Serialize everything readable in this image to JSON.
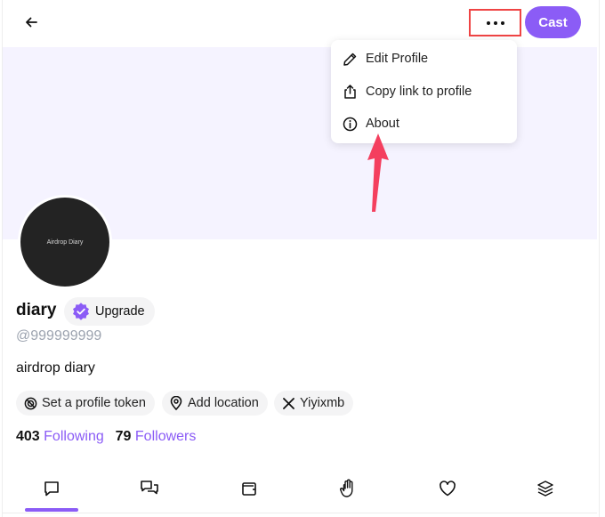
{
  "header": {
    "cast_label": "Cast",
    "back_icon": "arrow-left-icon",
    "more_icon": "ellipsis-icon"
  },
  "menu": {
    "items": [
      {
        "label": "Edit Profile",
        "icon": "pencil-icon"
      },
      {
        "label": "Copy link to profile",
        "icon": "share-icon"
      },
      {
        "label": "About",
        "icon": "info-icon"
      }
    ]
  },
  "profile": {
    "avatar_text": "Airdrop Diary",
    "name": "diary",
    "upgrade_label": "Upgrade",
    "handle": "@999999999",
    "bio": "airdrop diary",
    "chips": [
      {
        "label": "Set a profile token",
        "icon": "token-icon"
      },
      {
        "label": "Add location",
        "icon": "location-pin-icon"
      },
      {
        "label": "Yiyixmb",
        "icon": "x-logo-icon"
      }
    ],
    "following_count": "403",
    "following_label": "Following",
    "followers_count": "79",
    "followers_label": "Followers"
  },
  "tabs": [
    {
      "icon": "chat-bubble-icon",
      "active": true
    },
    {
      "icon": "replies-icon",
      "active": false
    },
    {
      "icon": "wallet-icon",
      "active": false
    },
    {
      "icon": "hand-icon",
      "active": false
    },
    {
      "icon": "heart-icon",
      "active": false
    },
    {
      "icon": "layers-icon",
      "active": false
    }
  ],
  "colors": {
    "accent": "#8b5cf6",
    "highlight_box": "#ef4444",
    "annotation_arrow": "#f43f5e",
    "banner": "#f5f3ff"
  }
}
